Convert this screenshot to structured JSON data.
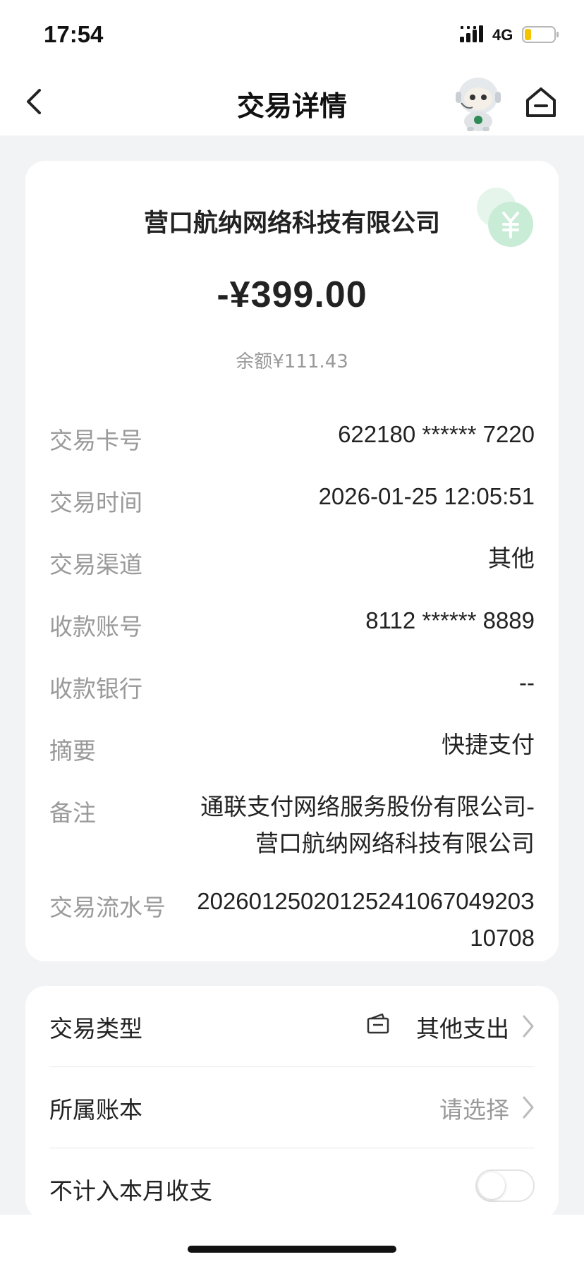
{
  "status_bar": {
    "time": "17:54",
    "network": "4G",
    "battery_color": "#f5c400"
  },
  "nav": {
    "title": "交易详情",
    "back_icon": "chevron-left-icon",
    "home_icon": "home-icon",
    "assistant_icon": "robot-assistant-icon"
  },
  "summary": {
    "merchant": "营口航纳网络科技有限公司",
    "amount": "-¥399.00",
    "balance": "余额¥111.43",
    "coin_icon": "yuan-coin-icon",
    "accent_color": "#8fd6a9"
  },
  "details": [
    {
      "label": "交易卡号",
      "value": "622180 ****** 7220"
    },
    {
      "label": "交易时间",
      "value": "2026-01-25 12:05:51"
    },
    {
      "label": "交易渠道",
      "value": "其他"
    },
    {
      "label": "收款账号",
      "value": "8112 ****** 8889"
    },
    {
      "label": "收款银行",
      "value": "--"
    },
    {
      "label": "摘要",
      "value": "快捷支付"
    },
    {
      "label": "备注",
      "value_line1": "通联支付网络服务股份有限公司-",
      "value_line2": "营口航纳网络科技有限公司"
    },
    {
      "label": "交易流水号",
      "value_line1": "2026012502012524106704920З",
      "value_line2": "10708"
    }
  ],
  "category": {
    "type_label": "交易类型",
    "type_value": "其他支出",
    "book_label": "所属账本",
    "book_value": "请选择",
    "exclude_label": "不计入本月收支",
    "exclude_on": false
  }
}
